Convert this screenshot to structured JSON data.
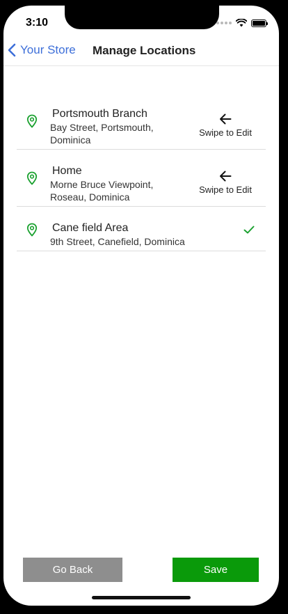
{
  "status_bar": {
    "time": "3:10"
  },
  "nav": {
    "back_label": "Your Store",
    "title": "Manage Locations"
  },
  "locations": [
    {
      "name": "Portsmouth Branch",
      "address": "Bay Street, Portsmouth, Dominica",
      "action": "Swipe to Edit"
    },
    {
      "name": "Home",
      "address": "Morne Bruce Viewpoint, Roseau, Dominica",
      "action": "Swipe to Edit"
    },
    {
      "name": "Cane field Area",
      "address": "9th Street, Canefield, Dominica",
      "selected": true
    }
  ],
  "footer": {
    "go_back_label": "Go Back",
    "save_label": "Save"
  },
  "colors": {
    "accent": "#3d6fd9",
    "pin": "#1aa12f",
    "save_button": "#0a9a0a",
    "go_back_button": "#8e8e8e"
  },
  "icons": {
    "back": "chevron-left-icon",
    "pin": "location-pin-icon",
    "swipe": "arrow-left-icon",
    "selected": "checkmark-icon",
    "wifi": "wifi-icon",
    "battery": "battery-icon"
  }
}
